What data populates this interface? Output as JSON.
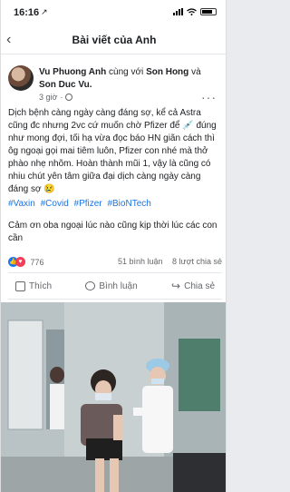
{
  "status_bar": {
    "time": "16:16",
    "location_arrow": "↗"
  },
  "nav": {
    "back_icon": "‹",
    "title": "Bài viết của Anh"
  },
  "post": {
    "author": "Vu Phuong Anh",
    "with_text": "cùng với",
    "tagged_1": "Son Hong",
    "and_text": "và",
    "tagged_2": "Son Duc Vu.",
    "time": "3 giờ",
    "dot": "·",
    "more": "···",
    "text_1": "Dịch bệnh càng ngày càng đáng sợ, kể cả Astra cũng đc nhưng 2vc cứ muốn chờ Pfizer để 💉 đúng như mong đợi, tối hạ vừa đọc báo HN giãn cách thì ôg ngoại gọi mai tiêm luôn, Pfizer con nhé mà thở phào nhẹ nhõm. Hoàn thành mũi 1, vậy là cũng có nhiu chút yên tâm giữa đại dịch càng ngày càng đáng sợ 😢",
    "hashtags": [
      "#Vaxin",
      "#Covid",
      "#Pfizer",
      "#BioNTech"
    ],
    "text_2": "Cảm ơn oba ngoại lúc nào cũng kịp thời lúc các con cần"
  },
  "reactions": {
    "count": "776",
    "comments": "51 bình luận",
    "shares": "8 lượt chia sẻ"
  },
  "actions": {
    "like": "Thích",
    "comment": "Bình luận",
    "share": "Chia sẻ"
  },
  "colors": {
    "link": "#1b74e4",
    "like": "#1877f2",
    "love": "#f33e58",
    "muted": "#65676b"
  }
}
